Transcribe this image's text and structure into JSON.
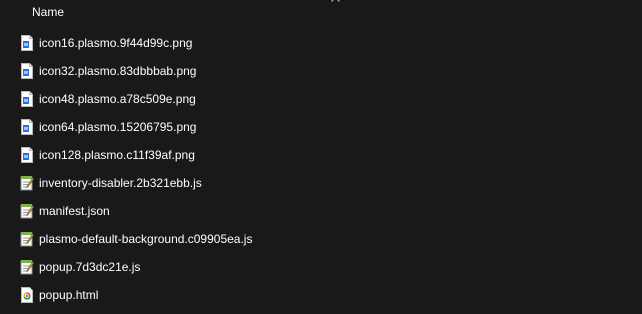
{
  "header": {
    "name_column": "Name"
  },
  "files": [
    {
      "name": "icon16.plasmo.9f44d99c.png",
      "icon": "png-image-icon"
    },
    {
      "name": "icon32.plasmo.83dbbbab.png",
      "icon": "png-image-icon"
    },
    {
      "name": "icon48.plasmo.a78c509e.png",
      "icon": "png-image-icon"
    },
    {
      "name": "icon64.plasmo.15206795.png",
      "icon": "png-image-icon"
    },
    {
      "name": "icon128.plasmo.c11f39af.png",
      "icon": "png-image-icon"
    },
    {
      "name": "inventory-disabler.2b321ebb.js",
      "icon": "js-notepad-icon"
    },
    {
      "name": "manifest.json",
      "icon": "json-notepad-icon"
    },
    {
      "name": "plasmo-default-background.c09905ea.js",
      "icon": "js-notepad-icon"
    },
    {
      "name": "popup.7d3dc21e.js",
      "icon": "js-notepad-icon"
    },
    {
      "name": "popup.html",
      "icon": "chrome-html-icon"
    }
  ],
  "colors": {
    "background": "#191919",
    "text": "#ffffff"
  }
}
